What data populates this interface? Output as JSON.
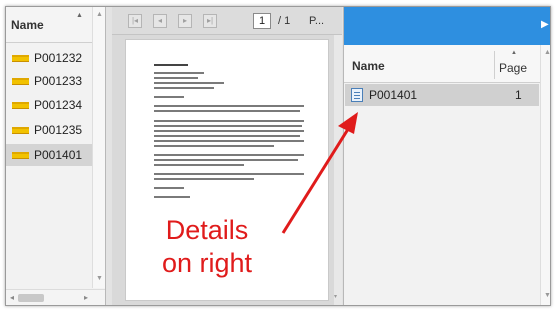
{
  "left_panel": {
    "header_label": "Name",
    "items": [
      {
        "label": "P001232",
        "selected": false
      },
      {
        "label": "P001233",
        "selected": false
      },
      {
        "label": "P001234",
        "selected": false
      },
      {
        "label": "P001235",
        "selected": false
      },
      {
        "label": "P001401",
        "selected": true
      }
    ]
  },
  "viewer": {
    "current_page": "1",
    "page_total": "/ 1",
    "overflow_label": "P..."
  },
  "details_panel": {
    "col_name": "Name",
    "col_page": "Page",
    "rows": [
      {
        "name": "P001401",
        "page": "1"
      }
    ]
  },
  "annotation": {
    "line1": "Details",
    "line2": "on right",
    "color": "#e01b1b"
  },
  "colors": {
    "accent_bar": "#2e8fe0",
    "selected_row": "#d4d4d4",
    "doc_icon": "#f2c200"
  }
}
